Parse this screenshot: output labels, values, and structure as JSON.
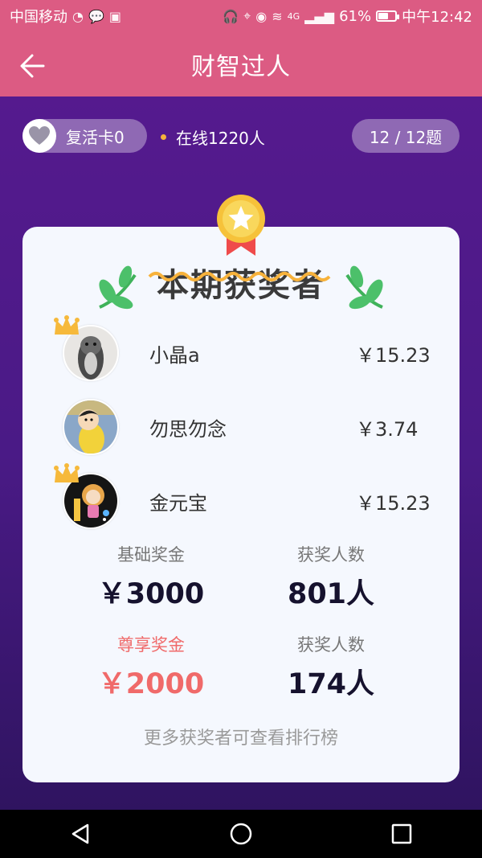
{
  "status": {
    "carrier": "中国移动",
    "network": "4G",
    "battery": "61%",
    "battery_level": 0.61,
    "time": "中午12:42"
  },
  "header": {
    "title": "财智过人",
    "back_icon": "arrow-left-icon"
  },
  "topbar": {
    "revive_label": "复活卡0",
    "online_text": "在线1220人",
    "progress": "12 / 12题"
  },
  "card": {
    "title": "本期获奖者",
    "winners": [
      {
        "name": "小晶a",
        "amount": "￥15.23",
        "crown": true
      },
      {
        "name": "勿思勿念",
        "amount": "￥3.74",
        "crown": false
      },
      {
        "name": "金元宝",
        "amount": "￥15.23",
        "crown": true
      }
    ],
    "stats": {
      "base_label": "基础奖金",
      "base_value": "￥3000",
      "base_count_label": "获奖人数",
      "base_count_value": "801人",
      "premium_label": "尊享奖金",
      "premium_value": "￥2000",
      "premium_count_label": "获奖人数",
      "premium_count_value": "174人"
    },
    "more_text": "更多获奖者可查看排行榜"
  },
  "colors": {
    "header_bg": "#dc5b83",
    "purple_bg": "#551a8e",
    "accent_red": "#f06a6a",
    "dot": "#f7b23b"
  }
}
